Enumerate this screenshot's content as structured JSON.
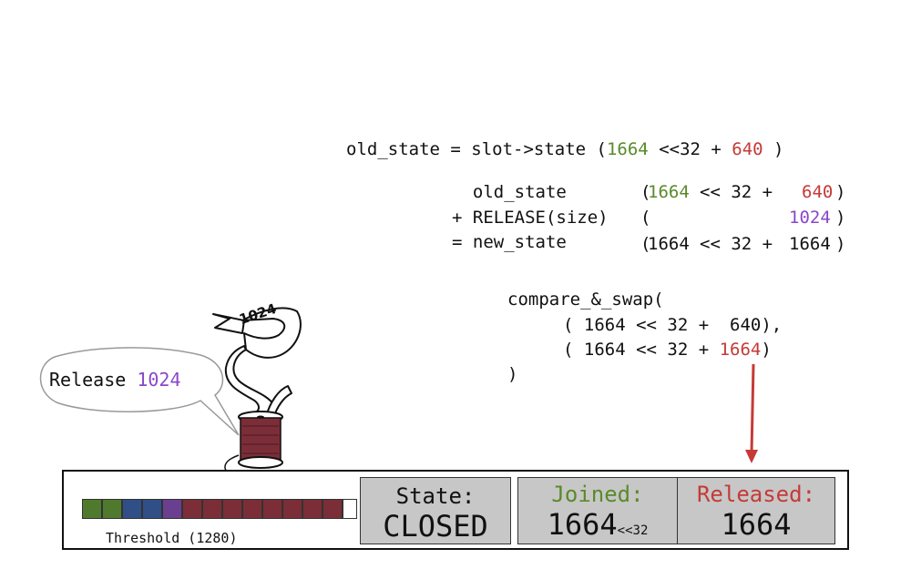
{
  "code": {
    "line1": {
      "prefix": "old_state = slot->state (",
      "joined": "1664",
      "mid": " <<32 + ",
      "released": "640",
      "suffix": " )"
    },
    "add_rows": [
      {
        "op": "  old_state",
        "open": "(",
        "joined": "1664",
        "shift": "<< 32 +",
        "released": "640",
        "close": ")"
      },
      {
        "op": "+ RELEASE(size)",
        "open": "(",
        "joined": "",
        "shift": "",
        "released": "1024",
        "close": ")"
      },
      {
        "op": "= new_state",
        "open": "(",
        "joined": "1664",
        "shift": "<< 32 +",
        "released": "1664",
        "close": ")"
      }
    ],
    "cas": {
      "call": "compare_&_swap(",
      "arg1": "( 1664 << 32 +  640),",
      "arg2_prefix": "( 1664 << 32 + ",
      "arg2_released": "1664",
      "arg2_suffix": ")",
      "close": ")"
    }
  },
  "bubble": {
    "label": "Release ",
    "amount": "1024"
  },
  "ribbon": {
    "text": "1024"
  },
  "panel": {
    "threshold_label": "Threshold (1280)",
    "segments": [
      {
        "color": "#4f7a2e"
      },
      {
        "color": "#4f7a2e"
      },
      {
        "color": "#2f4f86"
      },
      {
        "color": "#2f4f86"
      },
      {
        "color": "#6a3f8f"
      },
      {
        "color": "#7b2e38"
      },
      {
        "color": "#7b2e38"
      },
      {
        "color": "#7b2e38"
      },
      {
        "color": "#7b2e38"
      },
      {
        "color": "#7b2e38"
      },
      {
        "color": "#7b2e38"
      },
      {
        "color": "#7b2e38"
      },
      {
        "color": "#7b2e38"
      },
      {
        "color": "#ffffff"
      }
    ],
    "state": {
      "label": "State:",
      "value": "CLOSED"
    },
    "joined": {
      "label": "Joined:",
      "value": "1664",
      "suffix": "<<32"
    },
    "released": {
      "label": "Released:",
      "value": "1664"
    }
  },
  "colors": {
    "joined": "#5a8a2a",
    "released": "#c53a37",
    "release_amount": "#8a47c9",
    "spool": "#7b2e38",
    "box_fill": "#c7c7c7"
  }
}
